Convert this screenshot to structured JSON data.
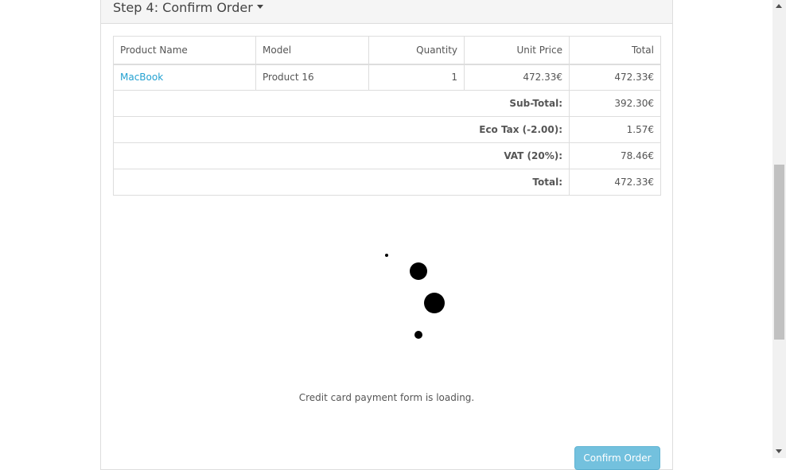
{
  "step": {
    "title": "Step 4: Confirm Order"
  },
  "table": {
    "headers": [
      "Product Name",
      "Model",
      "Quantity",
      "Unit Price",
      "Total"
    ],
    "rows": [
      {
        "name": "MacBook",
        "model": "Product 16",
        "quantity": "1",
        "unit_price": "472.33€",
        "total": "472.33€"
      }
    ],
    "totals": [
      {
        "label": "Sub-Total:",
        "value": "392.30€"
      },
      {
        "label": "Eco Tax (-2.00):",
        "value": "1.57€"
      },
      {
        "label": "VAT (20%):",
        "value": "78.46€"
      },
      {
        "label": "Total:",
        "value": "472.33€"
      }
    ]
  },
  "loading": {
    "message": "Credit card payment form is loading."
  },
  "confirm_button": {
    "label": "Confirm Order"
  },
  "colors": {
    "link": "#23a1d1",
    "button": "#5bb7d9",
    "spinner": "#000000"
  }
}
